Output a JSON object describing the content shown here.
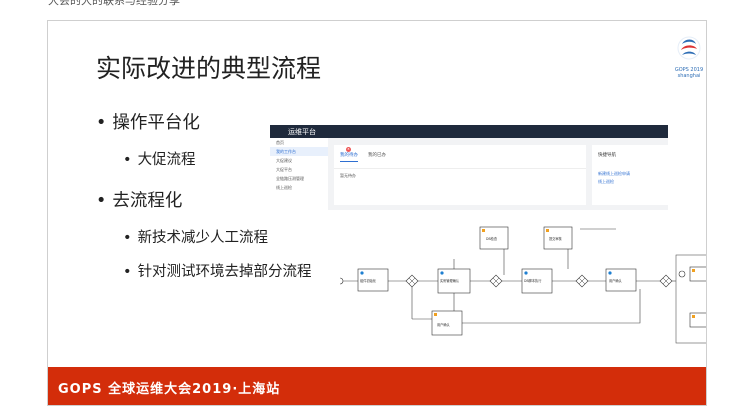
{
  "top_cut_text": "大会的大的联系与经验分享",
  "slide": {
    "title": "实际改进的典型流程",
    "logo_text": "GOPS 2019\nshanghai",
    "bullets": [
      {
        "label": "操作平台化"
      },
      {
        "label": "大促流程"
      },
      {
        "label": "去流程化"
      },
      {
        "label": "新技术减少人工流程"
      },
      {
        "label": "针对测试环境去掉部分流程"
      }
    ],
    "bullet_glyph": "•",
    "footer": "GOPS 全球运维大会2019·上海站"
  },
  "app": {
    "brand": "运维平台",
    "sidebar": [
      "首页",
      "我的工作台",
      "大促建议",
      "大促平台",
      "全链路压测管理",
      "线上巡检"
    ],
    "tabs": [
      "我的待办",
      "我的已办"
    ],
    "tab_badge": "8",
    "row": "暂无待办",
    "right_title": "快捷导航",
    "right_links": [
      "新建线上巡检申请",
      "线上巡检"
    ]
  },
  "flow": {
    "nodes": [
      "开始节点",
      "组件初始化",
      "实例管理确认",
      "DB检查",
      "DB脚本执行",
      "提交审核",
      "用户确认",
      "用户确认"
    ]
  },
  "colors": {
    "footer": "#d32d0a",
    "topbar": "#1f2a3c",
    "accent": "#2f6fd1"
  }
}
